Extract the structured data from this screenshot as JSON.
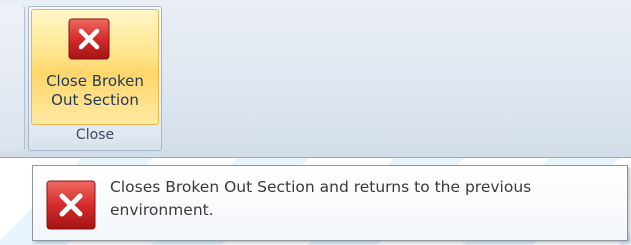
{
  "ribbon": {
    "group_label": "Close",
    "button": {
      "label_line1": "Close Broken",
      "label_line2": "Out Section",
      "icon": "close-x-icon",
      "accent": "#d42b2b"
    }
  },
  "tooltip": {
    "text": "Closes Broken Out Section and returns to the previous environment.",
    "icon": "close-x-icon"
  }
}
